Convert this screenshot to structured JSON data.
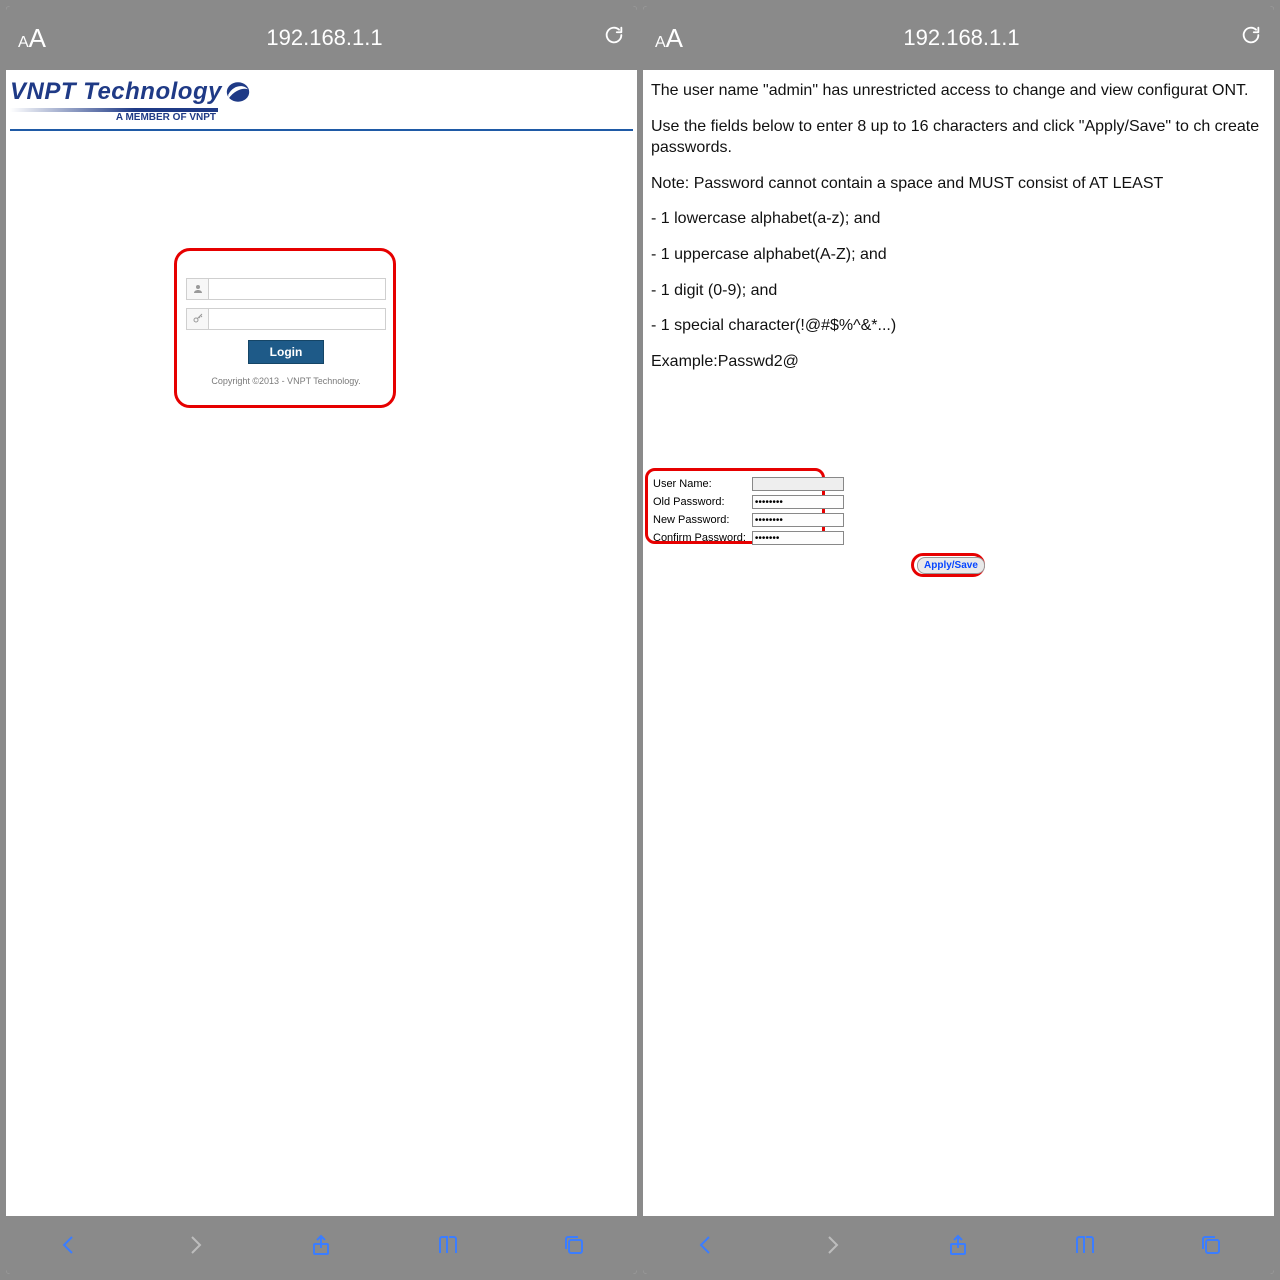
{
  "gap_color": "#8a8a8a",
  "left": {
    "addressbar": {
      "aA": "AA",
      "url": "192.168.1.1",
      "reload_icon": "reload"
    },
    "brand": {
      "name": "VNPT Technology",
      "subtitle": "A MEMBER OF VNPT"
    },
    "login": {
      "username_value": "",
      "password_value": "",
      "button_label": "Login",
      "copyright": "Copyright ©2013 - VNPT Technology."
    },
    "toolbar": {
      "back": "back",
      "forward": "forward",
      "share": "share",
      "bookmarks": "bookmarks",
      "tabs": "tabs"
    }
  },
  "right": {
    "addressbar": {
      "aA": "AA",
      "url": "192.168.1.1",
      "reload_icon": "reload"
    },
    "paragraphs": {
      "p1": "The user name \"admin\" has unrestricted access to change and view configurat ONT.",
      "p2": "Use the fields below to enter 8 up to 16 characters and click \"Apply/Save\" to ch create passwords.",
      "p3": "Note: Password cannot contain a space and MUST consist of AT LEAST",
      "b1": "- 1 lowercase alphabet(a-z); and",
      "b2": "- 1 uppercase alphabet(A-Z); and",
      "b3": "- 1 digit (0-9); and",
      "b4": "- 1 special character(!@#$%^&*...)",
      "ex": "Example:Passwd2@"
    },
    "form": {
      "labels": {
        "user": "User Name:",
        "old": "Old Password:",
        "new": "New Password:",
        "confirm": "Confirm Password:"
      },
      "values": {
        "user": "",
        "old": "••••••••",
        "new": "••••••••",
        "confirm": "•••••••"
      },
      "apply_label": "Apply/Save"
    },
    "toolbar": {
      "back": "back",
      "forward": "forward",
      "share": "share",
      "bookmarks": "bookmarks",
      "tabs": "tabs"
    }
  }
}
